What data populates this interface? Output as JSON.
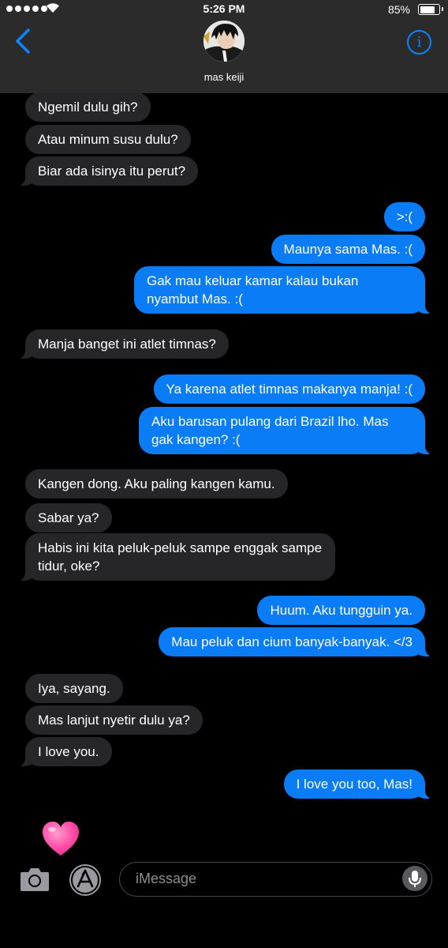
{
  "status_bar": {
    "time": "5:26 PM",
    "battery_percent": "85%",
    "battery_level": 0.85,
    "signal_bars": 5
  },
  "header": {
    "contact_name": "mas keiji",
    "back_icon": "chevron-left-icon",
    "info_icon": "info-icon",
    "info_glyph": "i"
  },
  "messages": [
    {
      "side": "recv",
      "text": "Ngemil dulu gih?"
    },
    {
      "side": "recv",
      "text": "Atau minum susu dulu?"
    },
    {
      "side": "recv",
      "text": "Biar ada isinya itu perut?"
    },
    {
      "side": "sent",
      "text": ">:("
    },
    {
      "side": "sent",
      "text": "Maunya sama Mas. :("
    },
    {
      "side": "sent",
      "text": "Gak mau keluar kamar kalau bukan nyambut Mas. :("
    },
    {
      "side": "recv",
      "text": "Manja banget ini atlet timnas?"
    },
    {
      "side": "sent",
      "text": "Ya karena atlet timnas makanya manja! :("
    },
    {
      "side": "sent",
      "text": "Aku barusan pulang dari Brazil lho. Mas gak kangen? :("
    },
    {
      "side": "recv",
      "text": "Kangen dong. Aku paling kangen kamu."
    },
    {
      "side": "recv",
      "text": "Sabar ya?"
    },
    {
      "side": "recv",
      "text": "Habis ini kita peluk-peluk sampe enggak sampe tidur, oke?"
    },
    {
      "side": "sent",
      "text": "Huum. Aku tungguin ya."
    },
    {
      "side": "sent",
      "text": "Mau peluk dan cium banyak-banyak. </3"
    },
    {
      "side": "recv",
      "text": "Iya, sayang."
    },
    {
      "side": "recv",
      "text": "Mas lanjut nyetir dulu ya?"
    },
    {
      "side": "recv",
      "text": "I love you."
    },
    {
      "side": "sent",
      "text": "I love you too, Mas!"
    }
  ],
  "input": {
    "placeholder": "iMessage"
  },
  "colors": {
    "sent_bubble": "#0a7cf6",
    "received_bubble": "#262628",
    "accent": "#0a84ff"
  }
}
